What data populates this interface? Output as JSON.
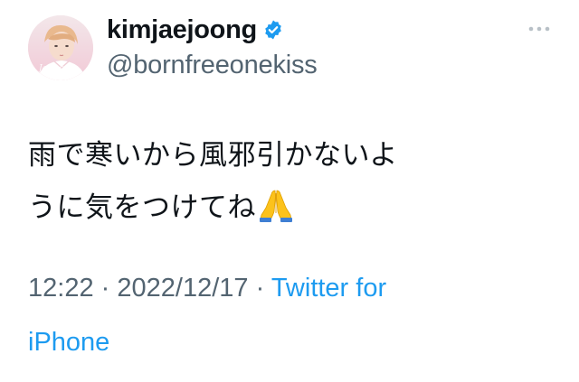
{
  "user": {
    "display_name": "kimjaejoong",
    "handle": "@bornfreeonekiss",
    "avatar_script": "Jaejoong",
    "verified": true
  },
  "tweet": {
    "text_line1": "雨で寒いから風邪引かないよ",
    "text_line2": "うに気をつけてね",
    "emoji": "folded-hands"
  },
  "meta": {
    "time": "12:22",
    "separator": "·",
    "date": "2022/12/17",
    "source_part1": "Twitter for",
    "source_part2": "iPhone"
  },
  "colors": {
    "text": "#0f1419",
    "secondary": "#536471",
    "link": "#1d9bf0",
    "verified": "#1d9bf0"
  }
}
